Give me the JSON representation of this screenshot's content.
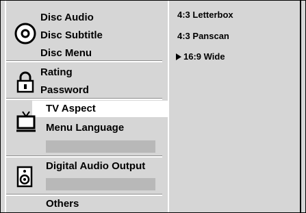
{
  "menu": {
    "disc_audio": "Disc Audio",
    "disc_subtitle": "Disc Subtitle",
    "disc_menu": "Disc Menu",
    "rating": "Rating",
    "password": "Password",
    "tv_aspect": "TV Aspect",
    "menu_language": "Menu Language",
    "digital_audio_output": "Digital Audio Output",
    "others": "Others"
  },
  "options": {
    "letterbox": "4:3 Letterbox",
    "panscan": "4:3 Panscan",
    "wide": "16:9 Wide"
  },
  "selected_option": "16:9 Wide",
  "icons": [
    "disc-icon",
    "padlock-icon",
    "tv-icon",
    "speaker-icon"
  ]
}
